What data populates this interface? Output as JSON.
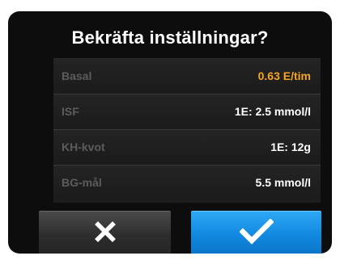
{
  "dialog": {
    "title": "Bekräfta inställningar?"
  },
  "settings": [
    {
      "label": "Basal",
      "value": "0.63 E/tim",
      "highlight": true
    },
    {
      "label": "ISF",
      "value": "1E: 2.5 mmol/l",
      "highlight": false
    },
    {
      "label": "KH-kvot",
      "value": "1E: 12g",
      "highlight": false
    },
    {
      "label": "BG-mål",
      "value": "5.5 mmol/l",
      "highlight": false
    }
  ],
  "buttons": {
    "cancel_icon": "close-icon",
    "confirm_icon": "checkmark-icon"
  },
  "colors": {
    "highlight": "#f5a623",
    "confirm": "#1188e0",
    "label": "#5c5c5c"
  }
}
